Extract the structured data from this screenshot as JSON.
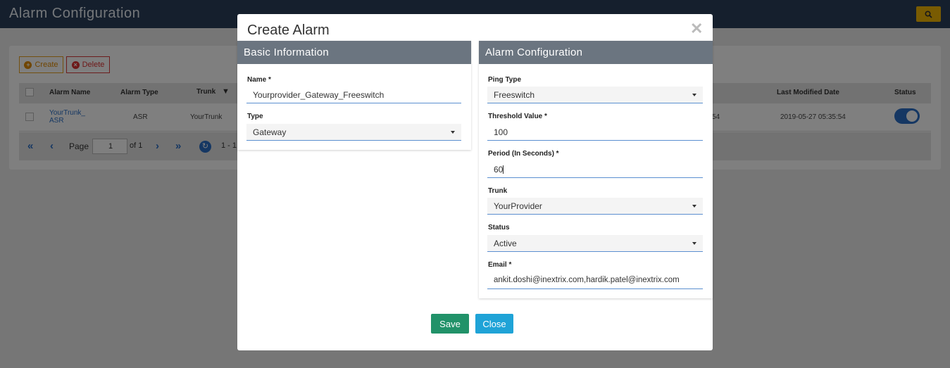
{
  "page": {
    "title": "Alarm Configuration"
  },
  "toolbar": {
    "create_label": "Create",
    "delete_label": "Delete"
  },
  "grid": {
    "columns": [
      "Alarm Name",
      "Alarm Type",
      "Trunk",
      "Last Modified Date",
      "Status"
    ],
    "row": {
      "alarm_name": "YourTrunk_ ASR",
      "alarm_type": "ASR",
      "trunk": "YourTrunk",
      "partial_value": "54",
      "last_modified": "2019-05-27 05:35:54",
      "status_on": true
    }
  },
  "pager": {
    "page_label": "Page",
    "page_value": "1",
    "of_label": "of 1",
    "range_text": "1 - 1"
  },
  "modal": {
    "title": "Create Alarm",
    "basic": {
      "heading": "Basic Information",
      "name_label": "Name *",
      "name_value": "Yourprovider_Gateway_Freeswitch",
      "type_label": "Type",
      "type_value": "Gateway"
    },
    "alarm": {
      "heading": "Alarm Configuration",
      "ping_type_label": "Ping Type",
      "ping_type_value": "Freeswitch",
      "threshold_label": "Threshold Value *",
      "threshold_value": "100",
      "period_label": "Period (In Seconds) *",
      "period_value": "60",
      "trunk_label": "Trunk",
      "trunk_value": "YourProvider",
      "status_label": "Status",
      "status_value": "Active",
      "email_label": "Email *",
      "email_value": "ankit.doshi@inextrix.com,hardik.patel@inextrix.com"
    },
    "save_label": "Save",
    "close_label": "Close"
  },
  "colors": {
    "header": "#2b3f5a",
    "panel_head": "#6b7580",
    "save": "#219269",
    "close": "#1fa3d7",
    "accent": "#2b6fc6"
  }
}
